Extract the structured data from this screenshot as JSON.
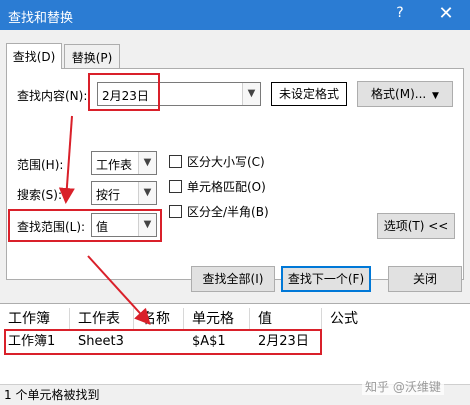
{
  "window": {
    "title": "查找和替换",
    "help_symbol": "?",
    "close_symbol": "✕"
  },
  "tabs": [
    {
      "label": "查找(D)",
      "active": true
    },
    {
      "label": "替换(P)",
      "active": false
    }
  ],
  "find": {
    "label": "查找内容(N):",
    "value": "2月23日",
    "no_format_label": "未设定格式",
    "format_button": "格式(M)..."
  },
  "options": {
    "within_label": "范围(H):",
    "within_value": "工作表",
    "search_label": "搜索(S):",
    "search_value": "按行",
    "lookin_label": "查找范围(L):",
    "lookin_value": "值",
    "match_case": {
      "label": "区分大小写(C)",
      "checked": false
    },
    "match_entire": {
      "label": "单元格匹配(O)",
      "checked": false
    },
    "match_byte": {
      "label": "区分全/半角(B)",
      "checked": false
    },
    "options_button": "选项(T) <<"
  },
  "actions": {
    "find_all": "查找全部(I)",
    "find_next": "查找下一个(F)",
    "close": "关闭"
  },
  "results": {
    "headers": [
      "工作簿",
      "工作表",
      "名称",
      "单元格",
      "值",
      "公式"
    ],
    "rows": [
      {
        "workbook": "工作簿1",
        "sheet": "Sheet3",
        "name": "",
        "cell": "$A$1",
        "value": "2月23日",
        "formula": ""
      }
    ]
  },
  "status": {
    "text": "1 个单元格被找到"
  },
  "watermark": "知乎 @沃维键",
  "colors": {
    "titlebar": "#2b7cd3",
    "highlight": "#d9202a",
    "focus": "#0078d7"
  }
}
